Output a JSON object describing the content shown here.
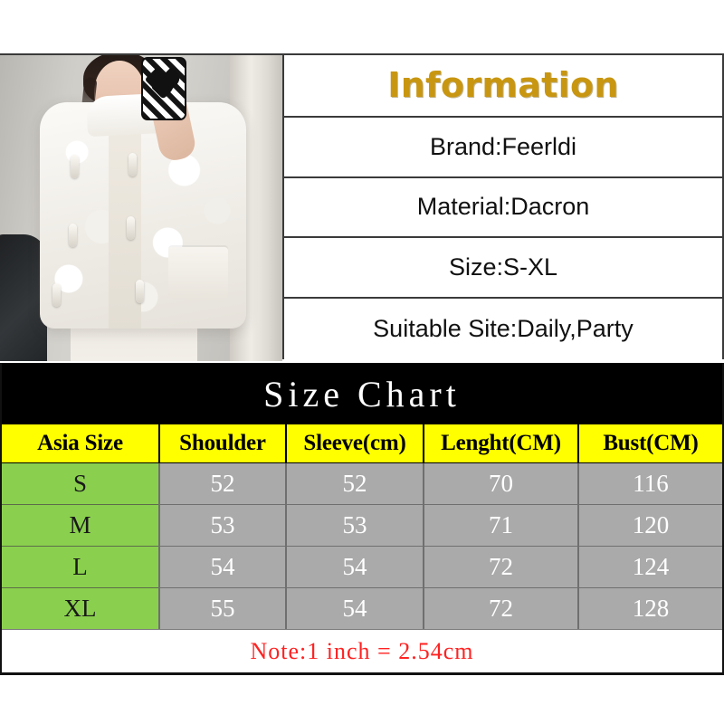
{
  "photo": {
    "alt_description": "Model wearing white fluffy faux fur coat taking a mirror selfie with a patterned phone case"
  },
  "information": {
    "title": "Information",
    "rows": [
      {
        "label": "Brand:Feerldi"
      },
      {
        "label": "Material:Dacron"
      },
      {
        "label": "Size:S-XL"
      },
      {
        "label": "Suitable Site:Daily,Party"
      }
    ]
  },
  "size_chart": {
    "title": "Size Chart",
    "headers": [
      "Asia Size",
      "Shoulder",
      "Sleeve(cm)",
      "Lenght(CM)",
      "Bust(CM)"
    ],
    "rows": [
      {
        "size": "S",
        "shoulder": "52",
        "sleeve": "52",
        "length": "70",
        "bust": "116"
      },
      {
        "size": "M",
        "shoulder": "53",
        "sleeve": "53",
        "length": "71",
        "bust": "120"
      },
      {
        "size": "L",
        "shoulder": "54",
        "sleeve": "54",
        "length": "72",
        "bust": "124"
      },
      {
        "size": "XL",
        "shoulder": "55",
        "sleeve": "54",
        "length": "72",
        "bust": "128"
      }
    ],
    "note": "Note:1 inch = 2.54cm"
  },
  "colors": {
    "title_gold": "#c89611",
    "header_yellow": "#ffff00",
    "size_green": "#8ad04e",
    "value_gray": "#aaaaaa",
    "note_red": "#ff2222",
    "band_black": "#000000"
  }
}
